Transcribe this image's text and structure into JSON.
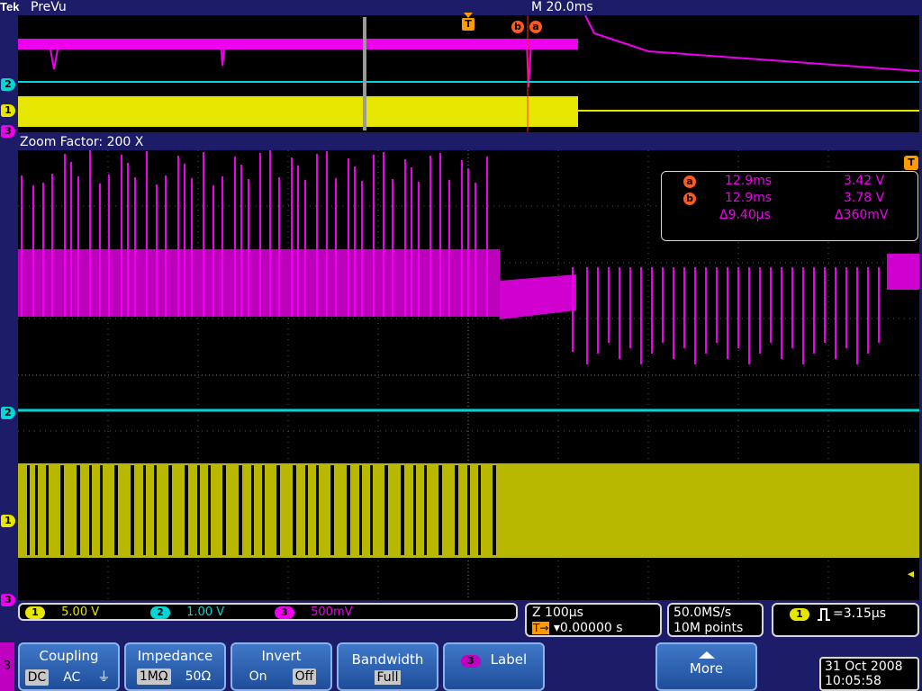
{
  "brand": "Tek",
  "mode": "PreVu",
  "timebase": "M 20.0ms",
  "zoom_label": "Zoom Factor: 200 X",
  "trigger_marker": "T",
  "cursor_labels": {
    "a": "a",
    "b": "b"
  },
  "channel_markers": {
    "ch1": "1",
    "ch2": "2",
    "ch3": "3"
  },
  "colors": {
    "ch1": "#e6e600",
    "ch2": "#00d6d6",
    "ch3": "#ee00ee",
    "cursor": "#ff5a1e"
  },
  "readout": {
    "row_a": {
      "label": "a",
      "time": "12.9ms",
      "volt": "3.42 V"
    },
    "row_b": {
      "label": "b",
      "time": "12.9ms",
      "volt": "3.78 V"
    },
    "delta": {
      "time": "Δ9.40μs",
      "volt": "Δ360mV"
    }
  },
  "channel_scales": [
    {
      "ch": "1",
      "value": "5.00 V"
    },
    {
      "ch": "2",
      "value": "1.00 V"
    },
    {
      "ch": "3",
      "value": "500mV"
    }
  ],
  "zoom_status": {
    "scale": "Z 100μs",
    "trig_pos": "▾0.00000 s",
    "trig_label": "T→"
  },
  "acq": {
    "rate": "50.0MS/s",
    "points": "10M points"
  },
  "trigger_readout": {
    "ch": "1",
    "icon": "pulse-icon",
    "value": "=3.15μs"
  },
  "menu": {
    "channel": "3",
    "coupling": {
      "label": "Coupling",
      "options": [
        "DC",
        "AC",
        "⏚"
      ],
      "selected": "DC"
    },
    "impedance": {
      "label": "Impedance",
      "options": [
        "1MΩ",
        "50Ω"
      ],
      "selected": "1MΩ"
    },
    "invert": {
      "label": "Invert",
      "options": [
        "On",
        "Off"
      ],
      "selected": "Off"
    },
    "bandwidth": {
      "label": "Bandwidth",
      "value": "Full"
    },
    "label": {
      "ch": "3",
      "text": "Label"
    },
    "more": "More"
  },
  "datetime": {
    "date": "31 Oct  2008",
    "time": "10:05:58"
  }
}
